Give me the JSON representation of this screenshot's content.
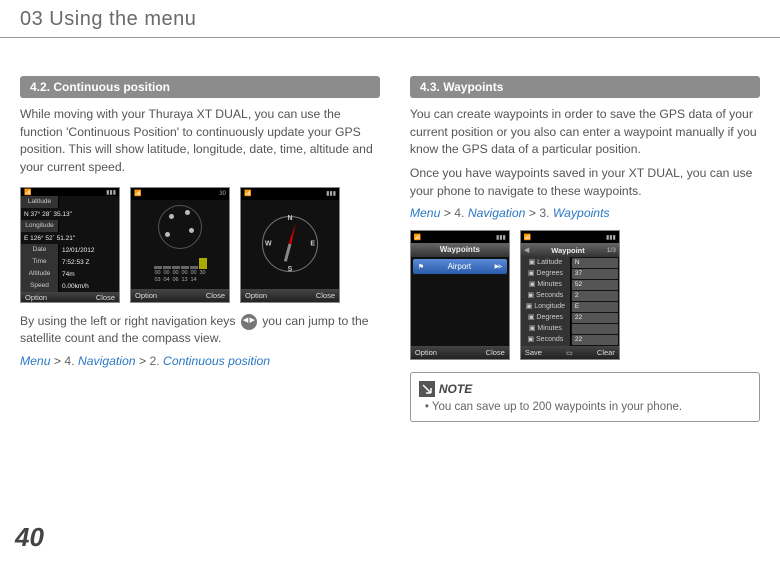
{
  "chapter": "03 Using the menu",
  "page_number": "40",
  "left": {
    "section_head": "4.2. Continuous position",
    "para1": "While moving with your Thuraya XT DUAL, you can use the function 'Continuous Position' to continuously update your GPS position. This will show latitude, longitude, date, time, altitude and your current speed.",
    "screen1": {
      "rows": [
        {
          "label": "Latitude",
          "value": ""
        },
        {
          "label": "",
          "value": "N 37° 28´ 35.13\""
        },
        {
          "label": "Longitude",
          "value": ""
        },
        {
          "label": "",
          "value": "E 126° 52´ 51.21\""
        },
        {
          "label": "Date",
          "value": "12/01/2012"
        },
        {
          "label": "Time",
          "value": "7:52:53 Z"
        },
        {
          "label": "Altitude",
          "value": "74m"
        },
        {
          "label": "Speed",
          "value": "0.00km/h"
        }
      ],
      "sk_left": "Option",
      "sk_right": "Close"
    },
    "screen2": {
      "sat_nums": [
        "00",
        "00",
        "00",
        "00",
        "00",
        "30"
      ],
      "sat_ids": [
        "03",
        "04",
        "06",
        "13",
        "14",
        ""
      ],
      "count_badge": "30",
      "sk_left": "Option",
      "sk_right": "Close"
    },
    "screen3": {
      "labels": {
        "n": "N",
        "s": "S",
        "e": "E",
        "w": "W"
      },
      "sk_left": "Option",
      "sk_right": "Close"
    },
    "para2_a": "By using the left or right navigation keys ",
    "para2_b": " you can jump to the satellite count and the compass view.",
    "nav": {
      "a": "Menu",
      "b": "Navigation",
      "c": "Continuous position",
      "n1": "4.",
      "n2": "2."
    }
  },
  "right": {
    "section_head": "4.3. Waypoints",
    "para1": "You can create waypoints in order to save the GPS data of your current position or you also can enter a waypoint manually if you know the GPS data of a particular position.",
    "para2": "Once you have waypoints saved in your XT DUAL, you can use your phone to navigate to these waypoints.",
    "nav": {
      "a": "Menu",
      "b": "Navigation",
      "c": "Waypoints",
      "n1": "4.",
      "n2": "3."
    },
    "screenA": {
      "title": "Waypoints",
      "item": "Airport",
      "sk_left": "Option",
      "sk_right": "Close"
    },
    "screenB": {
      "title": "Waypoint",
      "count": "1/3",
      "rows": [
        {
          "label": "Latitude",
          "value": "N"
        },
        {
          "label": "Degrees",
          "value": "37"
        },
        {
          "label": "Minutes",
          "value": "52"
        },
        {
          "label": "Seconds",
          "value": "2"
        },
        {
          "label": "Longitude",
          "value": "E"
        },
        {
          "label": "Degrees",
          "value": "22"
        },
        {
          "label": "Minutes",
          "value": ""
        },
        {
          "label": "Seconds",
          "value": "22"
        }
      ],
      "sk_left": "Save",
      "sk_right": "Clear"
    },
    "note_label": "NOTE",
    "note_item": "You can save up to 200 waypoints in your phone."
  }
}
